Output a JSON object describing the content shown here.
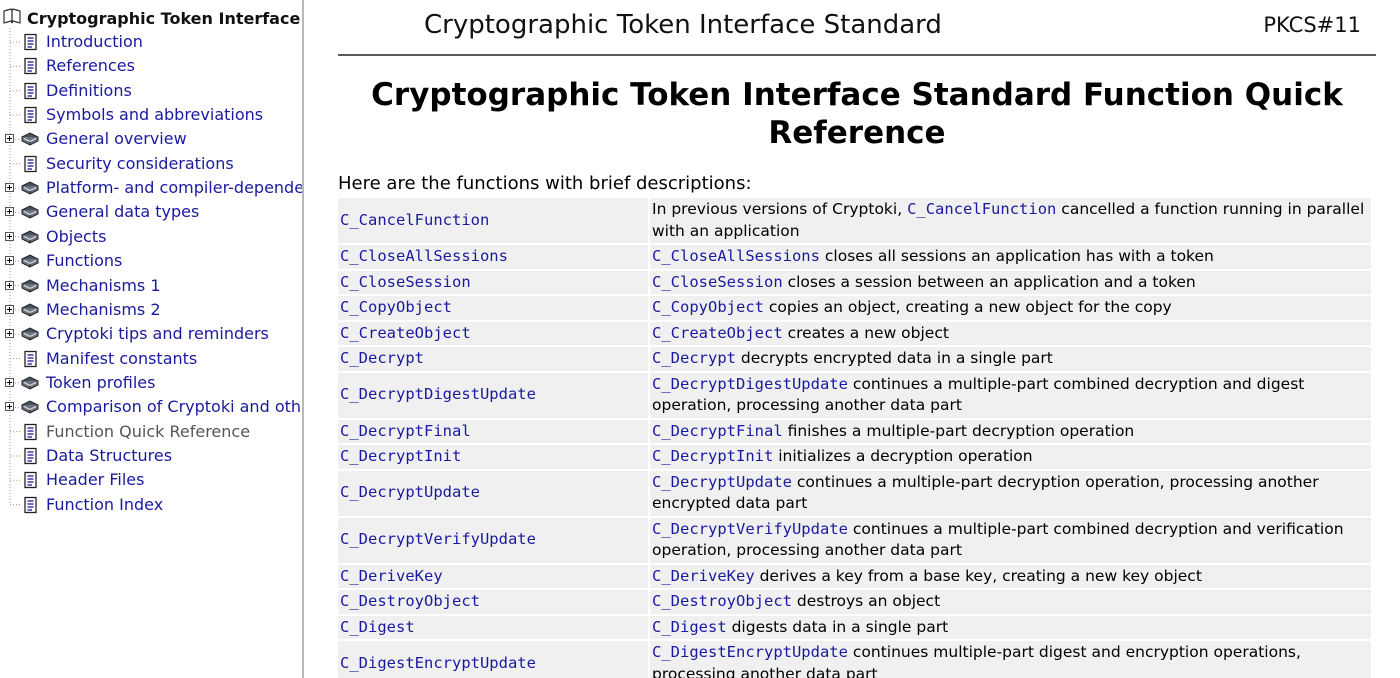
{
  "sidebar": {
    "root_label": "Cryptographic Token Interface",
    "items": [
      {
        "label": "Introduction",
        "icon": "page-icon",
        "expandable": false
      },
      {
        "label": "References",
        "icon": "page-icon",
        "expandable": false
      },
      {
        "label": "Definitions",
        "icon": "page-icon",
        "expandable": false
      },
      {
        "label": "Symbols and abbreviations",
        "icon": "page-icon",
        "expandable": false
      },
      {
        "label": "General overview",
        "icon": "book-icon",
        "expandable": true
      },
      {
        "label": "Security considerations",
        "icon": "page-icon",
        "expandable": false
      },
      {
        "label": "Platform- and compiler-depende",
        "icon": "book-icon",
        "expandable": true
      },
      {
        "label": "General data types",
        "icon": "book-icon",
        "expandable": true
      },
      {
        "label": "Objects",
        "icon": "book-icon",
        "expandable": true
      },
      {
        "label": "Functions",
        "icon": "book-icon",
        "expandable": true
      },
      {
        "label": "Mechanisms 1",
        "icon": "book-icon",
        "expandable": true
      },
      {
        "label": "Mechanisms 2",
        "icon": "book-icon",
        "expandable": true
      },
      {
        "label": "Cryptoki tips and reminders",
        "icon": "book-icon",
        "expandable": true
      },
      {
        "label": "Manifest constants",
        "icon": "page-icon",
        "expandable": false
      },
      {
        "label": "Token profiles",
        "icon": "book-icon",
        "expandable": true
      },
      {
        "label": "Comparison of Cryptoki and othe",
        "icon": "book-icon",
        "expandable": true
      },
      {
        "label": "Function Quick Reference",
        "icon": "page-icon",
        "expandable": false,
        "current": true
      },
      {
        "label": "Data Structures",
        "icon": "page-icon",
        "expandable": false
      },
      {
        "label": "Header Files",
        "icon": "page-icon",
        "expandable": false
      },
      {
        "label": "Function Index",
        "icon": "page-icon",
        "expandable": false
      }
    ]
  },
  "header": {
    "title": "Cryptographic Token Interface Standard",
    "right": "PKCS#11"
  },
  "main": {
    "title": "Cryptographic Token Interface Standard Function Quick Reference",
    "intro": "Here are the functions with brief descriptions:",
    "rows": [
      {
        "name": "C_CancelFunction",
        "pre": "In previous versions of Cryptoki, ",
        "link": "C_CancelFunction",
        "desc": " cancelled a function running in parallel with an application"
      },
      {
        "name": "C_CloseAllSessions",
        "pre": "",
        "link": "C_CloseAllSessions",
        "desc": " closes all sessions an application has with a token"
      },
      {
        "name": "C_CloseSession",
        "pre": "",
        "link": "C_CloseSession",
        "desc": " closes a session between an application and a token"
      },
      {
        "name": "C_CopyObject",
        "pre": "",
        "link": "C_CopyObject",
        "desc": " copies an object, creating a new object for the copy"
      },
      {
        "name": "C_CreateObject",
        "pre": "",
        "link": "C_CreateObject",
        "desc": " creates a new object"
      },
      {
        "name": "C_Decrypt",
        "pre": "",
        "link": "C_Decrypt",
        "desc": " decrypts encrypted data in a single part"
      },
      {
        "name": "C_DecryptDigestUpdate",
        "pre": "",
        "link": "C_DecryptDigestUpdate",
        "desc": " continues a multiple-part combined decryption and digest operation, processing another data part"
      },
      {
        "name": "C_DecryptFinal",
        "pre": "",
        "link": "C_DecryptFinal",
        "desc": " finishes a multiple-part decryption operation"
      },
      {
        "name": "C_DecryptInit",
        "pre": "",
        "link": "C_DecryptInit",
        "desc": " initializes a decryption operation"
      },
      {
        "name": "C_DecryptUpdate",
        "pre": "",
        "link": "C_DecryptUpdate",
        "desc": " continues a multiple-part decryption operation, processing another encrypted data part"
      },
      {
        "name": "C_DecryptVerifyUpdate",
        "pre": "",
        "link": "C_DecryptVerifyUpdate",
        "desc": " continues a multiple-part combined decryption and verification operation, processing another data part"
      },
      {
        "name": "C_DeriveKey",
        "pre": "",
        "link": "C_DeriveKey",
        "desc": " derives a key from a base key, creating a new key object"
      },
      {
        "name": "C_DestroyObject",
        "pre": "",
        "link": "C_DestroyObject",
        "desc": " destroys an object"
      },
      {
        "name": "C_Digest",
        "pre": "",
        "link": "C_Digest",
        "desc": " digests data in a single part"
      },
      {
        "name": "C_DigestEncryptUpdate",
        "pre": "",
        "link": "C_DigestEncryptUpdate",
        "desc": " continues multiple-part digest and encryption operations, processing another data part"
      }
    ]
  },
  "colors": {
    "link": "#1a1a9f",
    "cell_bg": "#f0f0f0",
    "current_item": "#555555"
  }
}
